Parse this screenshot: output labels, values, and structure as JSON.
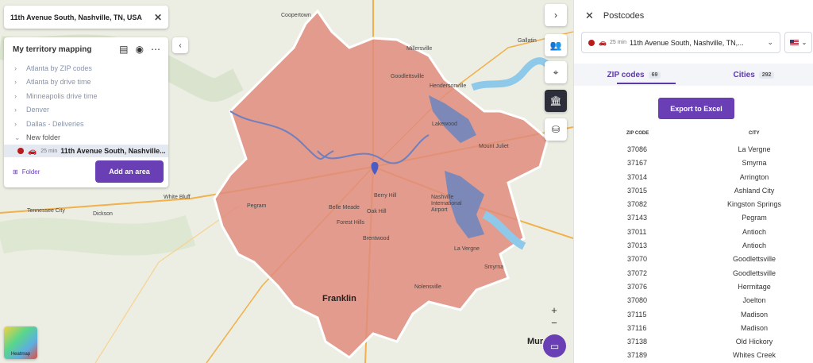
{
  "search": {
    "value": "11th Avenue South, Nashville, TN, USA"
  },
  "territory": {
    "title": "My territory mapping",
    "items": [
      {
        "label": "Atlanta by ZIP codes"
      },
      {
        "label": "Atlanta by drive time"
      },
      {
        "label": "Minneapolis drive time"
      },
      {
        "label": "Denver"
      },
      {
        "label": "Dallas - Deliveries"
      }
    ],
    "folder_label": "New folder",
    "selected": {
      "minutes": "25 min",
      "name": "11th Avenue South, Nashville..."
    },
    "folder_button": "Folder",
    "add_button": "Add an area"
  },
  "map": {
    "labels": {
      "coopertown": "Coopertown",
      "millersville": "Millersville",
      "goodlettsville": "Goodlettsville",
      "hendersonville": "Hendersonville",
      "gallatin": "Gallatin",
      "lakewood": "Lakewood",
      "mount_juliet": "Mount Juliet",
      "white_bluff": "White Bluff",
      "dickson": "Dickson",
      "tennessee_city": "Tennessee City",
      "pegram": "Pegram",
      "belle_meade": "Belle Meade",
      "berry_hill": "Berry Hill",
      "oak_hill": "Oak Hill",
      "forest_hills": "Forest Hills",
      "nashville_airport": "Nashville International Airport",
      "brentwood": "Brentwood",
      "la_vergne": "La Vergne",
      "smyrna": "Smyrna",
      "nolensville": "Nolensville",
      "franklin": "Franklin",
      "murfreesboro": "Mur"
    },
    "heatmap_label": "Heatmap",
    "zoom_in": "+",
    "zoom_out": "−",
    "colors": {
      "isochrone_fill": "#e08c7c",
      "isochrone_stroke": "#c96b5c",
      "water": "#8fc9ea",
      "lake": "#7b88b8"
    }
  },
  "panel": {
    "title": "Postcodes",
    "selector": {
      "minutes": "25 min",
      "address": "11th Avenue South, Nashville, TN,..."
    },
    "tabs": [
      {
        "label": "ZIP codes",
        "count": "69"
      },
      {
        "label": "Cities",
        "count": "292"
      }
    ],
    "export_button": "Export to Excel",
    "columns": {
      "zip": "ZIP CODE",
      "city": "CITY"
    },
    "rows": [
      {
        "zip": "37086",
        "city": "La Vergne"
      },
      {
        "zip": "37167",
        "city": "Smyrna"
      },
      {
        "zip": "37014",
        "city": "Arrington"
      },
      {
        "zip": "37015",
        "city": "Ashland City"
      },
      {
        "zip": "37082",
        "city": "Kingston Springs"
      },
      {
        "zip": "37143",
        "city": "Pegram"
      },
      {
        "zip": "37011",
        "city": "Antioch"
      },
      {
        "zip": "37013",
        "city": "Antioch"
      },
      {
        "zip": "37070",
        "city": "Goodlettsville"
      },
      {
        "zip": "37072",
        "city": "Goodlettsville"
      },
      {
        "zip": "37076",
        "city": "Hermitage"
      },
      {
        "zip": "37080",
        "city": "Joelton"
      },
      {
        "zip": "37115",
        "city": "Madison"
      },
      {
        "zip": "37116",
        "city": "Madison"
      },
      {
        "zip": "37138",
        "city": "Old Hickory"
      },
      {
        "zip": "37189",
        "city": "Whites Creek"
      }
    ]
  }
}
